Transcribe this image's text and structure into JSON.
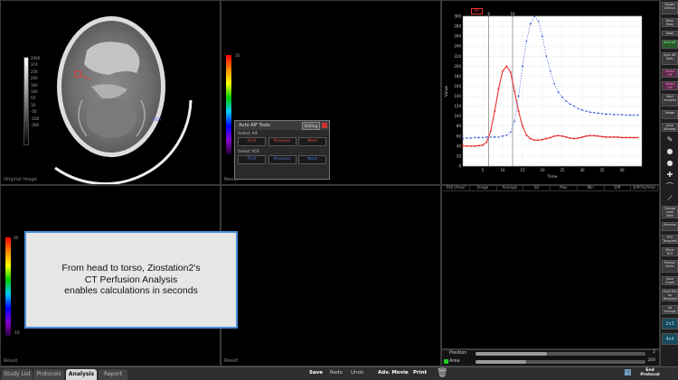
{
  "viewports": {
    "original_label": "Original Image",
    "result_label": "Result"
  },
  "grayscale_scale": [
    "2000",
    "374",
    "256",
    "200",
    "160",
    "100",
    "50",
    "10",
    "-50",
    "-100",
    "-200"
  ],
  "colorbar_top_tick": "10",
  "colorbar_bottom_label": "-10",
  "colorbar2_top": "20",
  "colorbar2_bottom": "-10",
  "aif_dialog": {
    "title": "Auto AIF Tools",
    "setting_label": "Setting",
    "select_aif": "Select AIF",
    "select_vof": "Select VOF",
    "first": "First",
    "previous": "Previous",
    "next": "Next"
  },
  "chart_data": {
    "type": "line",
    "tag": "AIF",
    "xlabel": "Time",
    "ylabel": "Value",
    "xlim": [
      0,
      45
    ],
    "ylim": [
      0,
      300
    ],
    "x_ticks": [
      5,
      10,
      15,
      20,
      25,
      30,
      35,
      40
    ],
    "y_ticks": [
      0,
      20,
      40,
      60,
      80,
      100,
      120,
      140,
      160,
      180,
      200,
      220,
      240,
      260,
      280,
      300
    ],
    "markers": [
      {
        "x": 6.5,
        "label": "6"
      },
      {
        "x": 12.5,
        "label": "10"
      }
    ],
    "series": [
      {
        "color": "#e83030",
        "x": [
          0,
          1,
          2,
          3,
          4,
          5,
          6,
          7,
          8,
          9,
          10,
          11,
          12,
          13,
          14,
          15,
          16,
          17,
          18,
          19,
          20,
          21,
          22,
          23,
          24,
          25,
          26,
          27,
          28,
          29,
          30,
          31,
          32,
          33,
          34,
          35,
          36,
          37,
          38,
          39,
          40,
          41,
          42,
          43,
          44
        ],
        "values": [
          41,
          40,
          40,
          40,
          41,
          42,
          48,
          70,
          110,
          155,
          190,
          200,
          188,
          150,
          110,
          80,
          62,
          55,
          52,
          52,
          53,
          55,
          57,
          60,
          61,
          60,
          58,
          56,
          55,
          56,
          58,
          60,
          61,
          61,
          60,
          59,
          58,
          58,
          58,
          58,
          57,
          57,
          57,
          57,
          57
        ]
      },
      {
        "color": "#3050d8",
        "x": [
          0,
          1,
          2,
          3,
          4,
          5,
          6,
          7,
          8,
          9,
          10,
          11,
          12,
          13,
          14,
          15,
          16,
          17,
          18,
          19,
          20,
          21,
          22,
          23,
          24,
          25,
          26,
          27,
          28,
          29,
          30,
          31,
          32,
          33,
          34,
          35,
          36,
          37,
          38,
          39,
          40,
          41,
          42,
          43,
          44
        ],
        "values": [
          55,
          56,
          56,
          57,
          57,
          57,
          58,
          58,
          58,
          58,
          60,
          62,
          68,
          90,
          140,
          200,
          250,
          285,
          300,
          290,
          260,
          220,
          190,
          165,
          148,
          138,
          130,
          124,
          120,
          115,
          112,
          110,
          108,
          107,
          106,
          105,
          104,
          104,
          103,
          103,
          103,
          102,
          102,
          102,
          102
        ]
      }
    ]
  },
  "table_columns": [
    "ROI (Area)",
    "Image",
    "Average",
    "SD",
    "Max",
    "Min",
    "Diff",
    "Diff(%)/Area"
  ],
  "sliders": [
    {
      "label": "Position",
      "value": "2",
      "fraction": 0.42
    },
    {
      "label": "Area",
      "value": "200",
      "fraction": 0.3
    }
  ],
  "toolbar": [
    {
      "label": "Region Extract",
      "style": "normal"
    },
    {
      "label": "Bone Mask",
      "style": "normal"
    },
    {
      "label": "Mask",
      "style": "normal"
    },
    {
      "label": "Auto AIF",
      "style": "green"
    },
    {
      "label": "Auto AIF Tools",
      "style": "normal"
    },
    {
      "label": "Select AIF",
      "style": "pink"
    },
    {
      "label": "Select VOF",
      "style": "pink"
    },
    {
      "label": "Start Analysis",
      "style": "normal"
    },
    {
      "label": "Merge",
      "style": "normal"
    },
    {
      "label": "Auto Window",
      "style": "normal"
    },
    {
      "label": "Change Color Table",
      "style": "normal"
    },
    {
      "label": "Reverse",
      "style": "normal"
    },
    {
      "label": "ROI Template",
      "style": "normal"
    },
    {
      "label": "Mirror ROI",
      "style": "normal"
    },
    {
      "label": "Display Items",
      "style": "normal"
    },
    {
      "label": "Save Graph",
      "style": "normal"
    },
    {
      "label": "Save ROI as Template",
      "style": "normal"
    },
    {
      "label": "Alt Settings",
      "style": "normal"
    },
    {
      "label": "2x3",
      "style": "cyan"
    },
    {
      "label": "4x4",
      "style": "cyan"
    }
  ],
  "bottom_tabs": [
    "Study List",
    "Protocols",
    "Analysis",
    "Report"
  ],
  "active_tab": "Analysis",
  "bottom_buttons": [
    "Save",
    "Redo",
    "Undo",
    "Adv. Movie",
    "Print",
    "End Protocol"
  ],
  "caption": {
    "line1": "From head to torso, Ziostation2's",
    "line2": "CT Perfusion Analysis",
    "line3": "enables calculations in seconds"
  }
}
